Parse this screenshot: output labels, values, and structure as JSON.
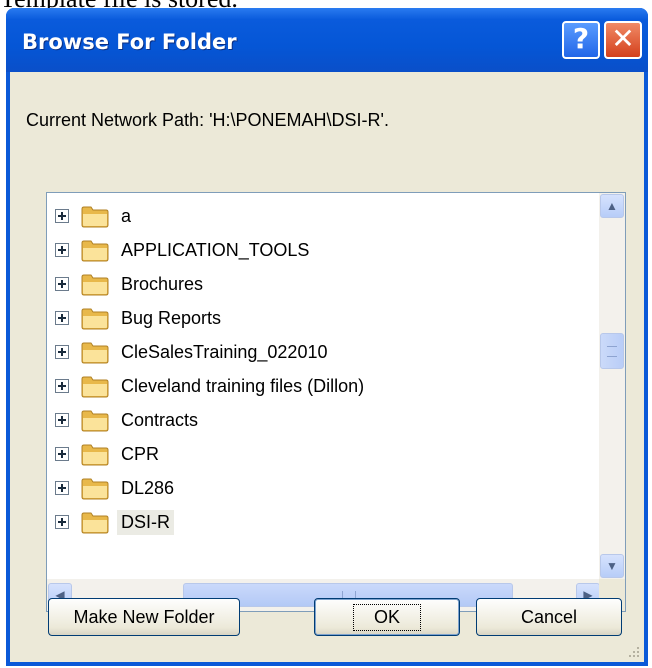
{
  "above_text": "Template file is stored.",
  "window": {
    "title": "Browse For Folder",
    "help_glyph": "?",
    "close_glyph": "✕"
  },
  "current_path_label": "Current Network Path: 'H:\\PONEMAH\\DSI-R'.",
  "folders": [
    {
      "name": "a",
      "selected": false
    },
    {
      "name": "APPLICATION_TOOLS",
      "selected": false
    },
    {
      "name": "Brochures",
      "selected": false
    },
    {
      "name": "Bug Reports",
      "selected": false
    },
    {
      "name": "CleSalesTraining_022010",
      "selected": false
    },
    {
      "name": "Cleveland training files (Dillon)",
      "selected": false
    },
    {
      "name": "Contracts",
      "selected": false
    },
    {
      "name": "CPR",
      "selected": false
    },
    {
      "name": "DL286",
      "selected": false
    },
    {
      "name": "DSI-R",
      "selected": true
    }
  ],
  "scroll": {
    "vertical_position": 0.35,
    "horizontal_position": 0.3
  },
  "buttons": {
    "make_new_folder": "Make New Folder",
    "ok": "OK",
    "cancel": "Cancel"
  },
  "colors": {
    "titlebar": "#0556d6",
    "dialog_bg": "#ece9d8",
    "close_button": "#d4401c",
    "selection": "#ebebe4"
  }
}
